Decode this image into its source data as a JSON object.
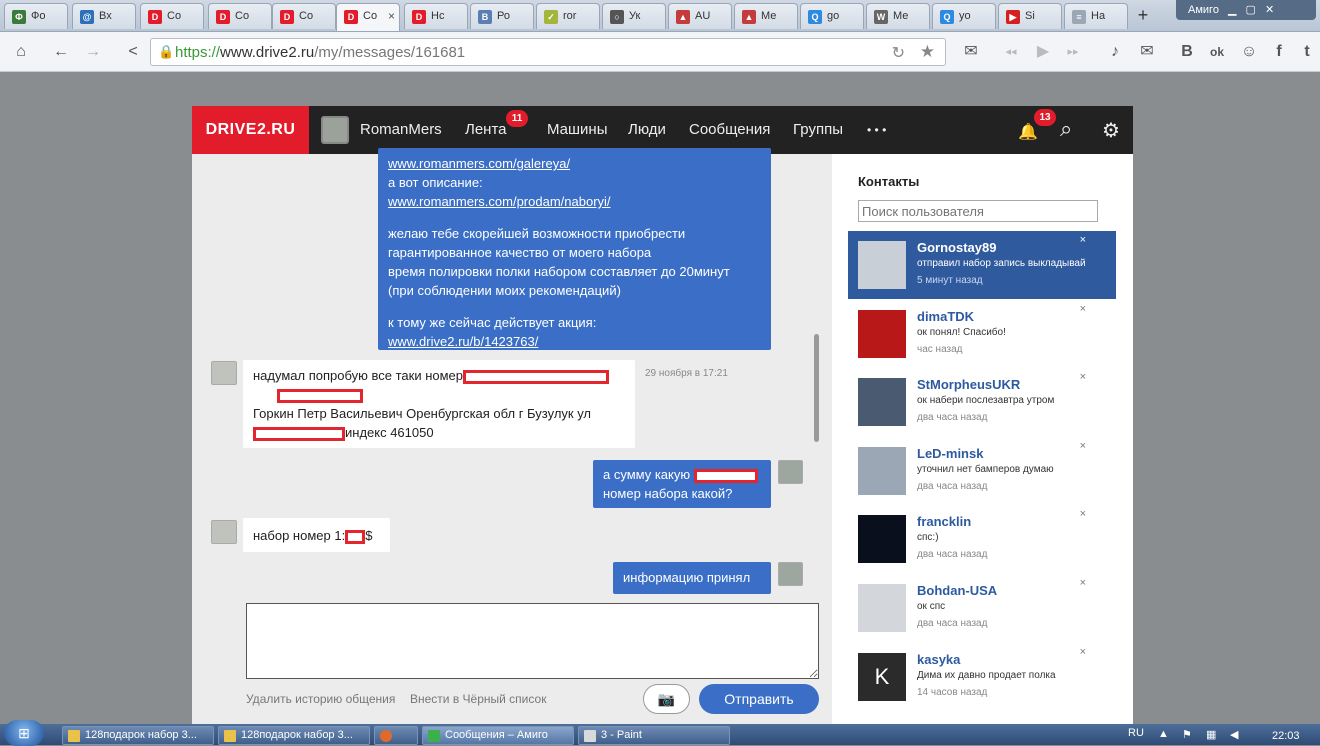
{
  "browser": {
    "tabs": [
      {
        "label": "Фо",
        "fav": "Ф",
        "color": "#3a7a3a"
      },
      {
        "label": "Вх",
        "fav": "@",
        "color": "#2d6fb8"
      },
      {
        "label": "Со",
        "fav": "D",
        "color": "#e31c2c"
      },
      {
        "label": "Со",
        "fav": "D",
        "color": "#e31c2c"
      },
      {
        "label": "Со",
        "fav": "D",
        "color": "#e31c2c"
      },
      {
        "label": "Со",
        "fav": "D",
        "color": "#e31c2c",
        "active": true
      },
      {
        "label": "Нс",
        "fav": "D",
        "color": "#e31c2c"
      },
      {
        "label": "Ро",
        "fav": "B",
        "color": "#5b7fb3"
      },
      {
        "label": "ror",
        "fav": "✓",
        "color": "#a3b53a"
      },
      {
        "label": "Ук",
        "fav": "○",
        "color": "#555555"
      },
      {
        "label": "AU",
        "fav": "▲",
        "color": "#c53a3a"
      },
      {
        "label": "Ме",
        "fav": "▲",
        "color": "#c53a3a"
      },
      {
        "label": "go",
        "fav": "Q",
        "color": "#2d8ae0"
      },
      {
        "label": "Ме",
        "fav": "W",
        "color": "#666666"
      },
      {
        "label": "yo",
        "fav": "Q",
        "color": "#2d8ae0"
      },
      {
        "label": "Si",
        "fav": "▶",
        "color": "#d42020"
      },
      {
        "label": "На",
        "fav": "≡",
        "color": "#9aa8b6"
      }
    ],
    "new_tab": "+",
    "window_user": "Амиго",
    "url_proto": "https://",
    "url_host": "www.drive2.ru",
    "url_path": "/my/messages/161681",
    "icons": {
      "home": "⌂",
      "back": "←",
      "forward": "→",
      "share": "<",
      "mail": "✉",
      "prev": "◂◂",
      "play": "▶",
      "next": "▸▸",
      "music": "♪",
      "chat": "✉",
      "vk": "B",
      "ok": "ok",
      "group": "☺",
      "fb": "f",
      "tw": "t"
    }
  },
  "site": {
    "logo": "DRIVE2.RU",
    "user_name": "RomanMers",
    "nav": {
      "feed": "Лента",
      "feed_badge": "11",
      "cars": "Машины",
      "people": "Люди",
      "messages": "Сообщения",
      "groups": "Группы",
      "more": "• • •"
    },
    "notif_badge": "13",
    "icons": {
      "bell": "🔔",
      "search": "⌕",
      "gear": "⚙"
    }
  },
  "chat": {
    "msg1": {
      "link1": "www.romanmers.com/galereya/",
      "text1": "а вот описание:",
      "link2": "www.romanmers.com/prodam/naboryi/",
      "p2_l1": "желаю тебе скорейшей возможности приобрести",
      "p2_l2": "гарантированное качество от моего набора",
      "p2_l3": "время полировки полки набором составляет до 20минут",
      "p2_l4": "(при соблюдении моих рекомендаций)",
      "p3_l1": "к тому же сейчас действует акция:",
      "link3": "www.drive2.ru/b/1423763/"
    },
    "msg2": {
      "l1": "надумал попробую все таки номер",
      "l3": "Горкин Петр Васильевич Оренбургская обл г Бузулук ул",
      "l4_suffix": "индекс 461050",
      "time": "29 ноября в 17:21"
    },
    "msg3": {
      "l1": "а сумму какую",
      "l2": "номер набора какой?"
    },
    "msg4": {
      "prefix": "набор номер 1:",
      "suffix": "$"
    },
    "msg5": {
      "text": "информацию принял"
    },
    "delete_history": "Удалить историю общения",
    "blacklist": "Внести в Чёрный список",
    "send": "Отправить",
    "camera_icon": "📷"
  },
  "contacts": {
    "title": "Контакты",
    "search_placeholder": "Поиск пользователя",
    "close": "×",
    "items": [
      {
        "name": "Gornostay89",
        "msg": "отправил набор запись выкладывай",
        "time": "5 минут назад",
        "selected": true,
        "photo": "#c9cfd6"
      },
      {
        "name": "dimaTDK",
        "msg": "ок понял! Спасибо!",
        "time": "час назад",
        "photo": "#b81818"
      },
      {
        "name": "StMorpheusUKR",
        "msg": "ок набери послезавтра утром",
        "time": "два часа назад",
        "photo": "#4a5a70"
      },
      {
        "name": "LeD-minsk",
        "msg": "уточнил нет бамперов думаю",
        "time": "два часа назад",
        "photo": "#9ca7b6"
      },
      {
        "name": "francklin",
        "msg": "спс:)",
        "time": "два часа назад",
        "photo": "#0a0f1e"
      },
      {
        "name": "Bohdan-USA",
        "msg": "ок спс",
        "time": "два часа назад",
        "photo": "#d3d6da"
      },
      {
        "name": "kasyka",
        "msg": "Дима их давно продает полка",
        "time": "14 часов назад",
        "photo": "#2b2b2b",
        "letter": "K"
      }
    ]
  },
  "taskbar": {
    "start_icon": "⊞",
    "tasks": [
      "128подарок набор 3...",
      "128подарок набор 3...",
      "",
      "Сообщения – Амиго",
      "3 - Paint"
    ],
    "lang": "RU",
    "clock": "22:03"
  }
}
